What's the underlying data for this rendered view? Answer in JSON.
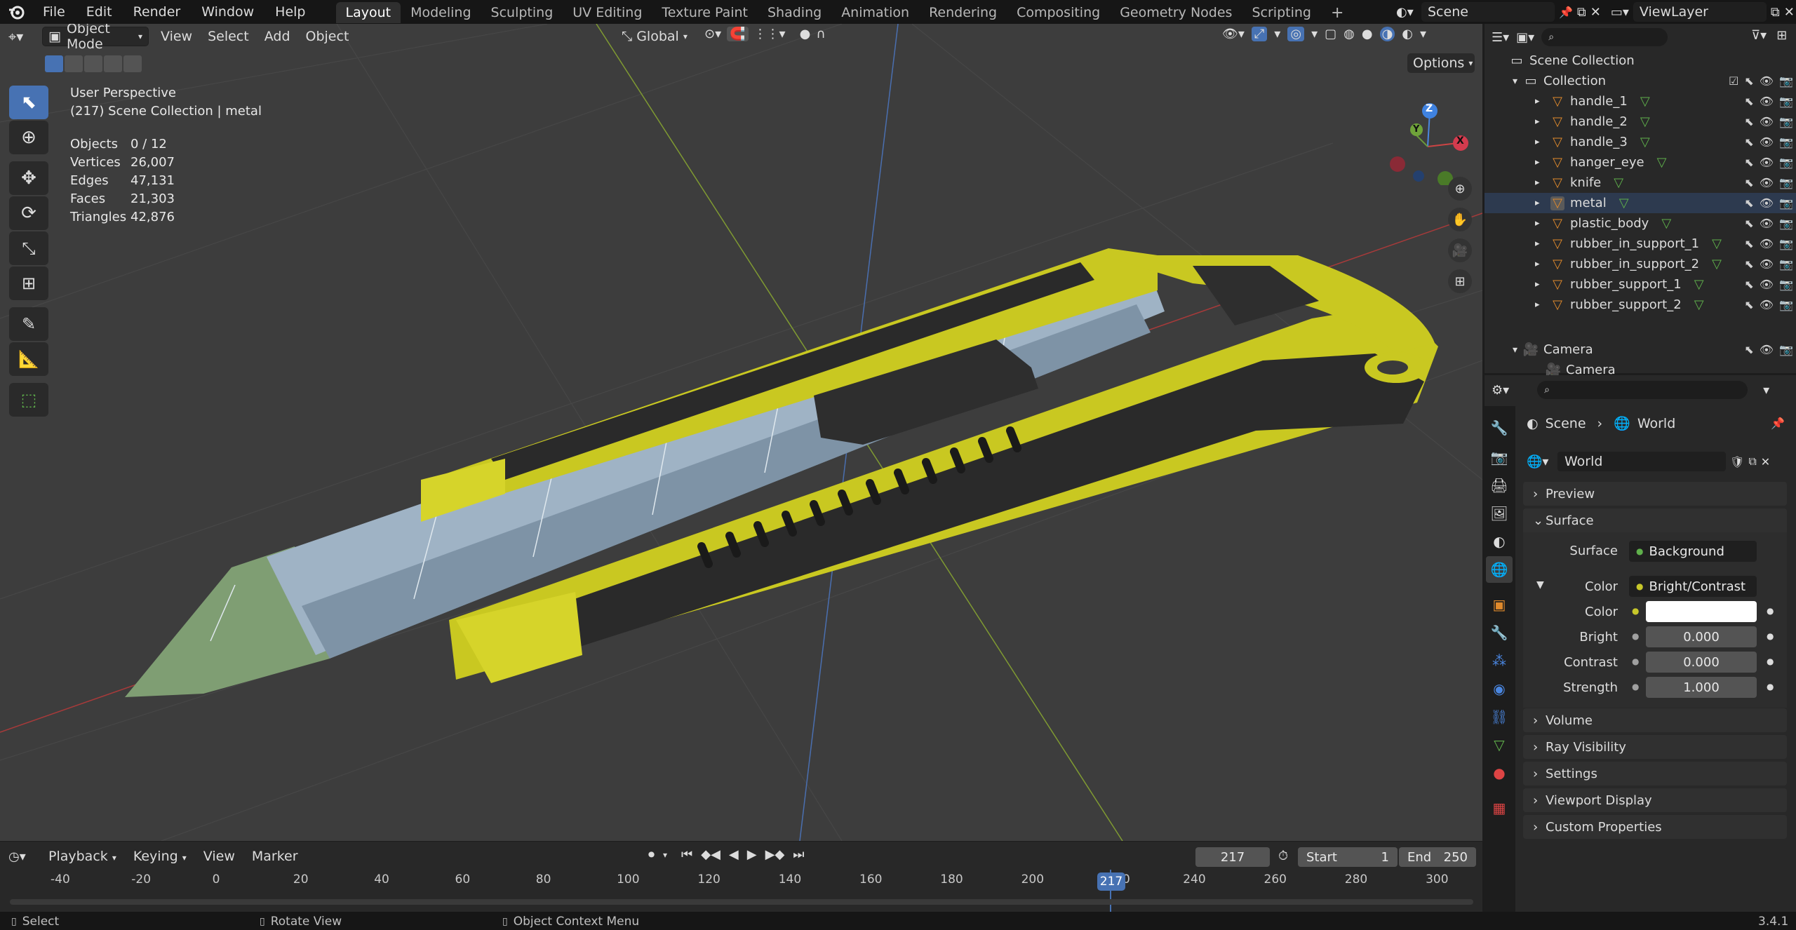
{
  "topbar": {
    "menus": [
      "File",
      "Edit",
      "Render",
      "Window",
      "Help"
    ],
    "workspaces": [
      "Layout",
      "Modeling",
      "Sculpting",
      "UV Editing",
      "Texture Paint",
      "Shading",
      "Animation",
      "Rendering",
      "Compositing",
      "Geometry Nodes",
      "Scripting"
    ],
    "active_workspace": "Layout",
    "add_tab": "+",
    "scene": "Scene",
    "view_layer": "ViewLayer"
  },
  "viewport_header": {
    "mode": "Object Mode",
    "menus": [
      "View",
      "Select",
      "Add",
      "Object"
    ],
    "transform_orientation": "Global",
    "options": "Options"
  },
  "overlay_info": {
    "view": "User Perspective",
    "context": "(217) Scene Collection | metal",
    "stats": [
      {
        "label": "Objects",
        "value": "0 / 12"
      },
      {
        "label": "Vertices",
        "value": "26,007"
      },
      {
        "label": "Edges",
        "value": "47,131"
      },
      {
        "label": "Faces",
        "value": "21,303"
      },
      {
        "label": "Triangles",
        "value": "42,876"
      }
    ]
  },
  "gizmo": {
    "x": "X",
    "y": "Y",
    "z": "Z"
  },
  "outliner": {
    "root": "Scene Collection",
    "collection": "Collection",
    "objects": [
      "handle_1",
      "handle_2",
      "handle_3",
      "hanger_eye",
      "knife",
      "metal",
      "plastic_body",
      "rubber_in_support_1",
      "rubber_in_support_2",
      "rubber_support_1",
      "rubber_support_2"
    ],
    "selected": "metal",
    "camera_object": "Camera",
    "camera_data": "Camera"
  },
  "properties": {
    "breadcrumb_scene": "Scene",
    "breadcrumb_world": "World",
    "world_name": "World",
    "panels": {
      "preview": "Preview",
      "surface": "Surface",
      "volume": "Volume",
      "ray_visibility": "Ray Visibility",
      "settings": "Settings",
      "viewport_display": "Viewport Display",
      "custom_properties": "Custom Properties"
    },
    "surface_label": "Surface",
    "surface_value": "Background",
    "color_label": "Color",
    "color_value": "Bright/Contrast",
    "sub_color_label": "Color",
    "bright_label": "Bright",
    "bright_value": "0.000",
    "contrast_label": "Contrast",
    "contrast_value": "0.000",
    "strength_label": "Strength",
    "strength_value": "1.000"
  },
  "timeline": {
    "menus": [
      "Playback",
      "Keying",
      "View",
      "Marker"
    ],
    "current_frame": "217",
    "start_label": "Start",
    "start_value": "1",
    "end_label": "End",
    "end_value": "250",
    "ruler": [
      "-40",
      "-20",
      "0",
      "20",
      "40",
      "60",
      "80",
      "100",
      "120",
      "140",
      "160",
      "180",
      "200",
      "0",
      "240",
      "260",
      "280",
      "300"
    ],
    "playhead_label": "217"
  },
  "statusbar": {
    "select": "Select",
    "rotate": "Rotate View",
    "context_menu": "Object Context Menu",
    "version": "3.4.1"
  },
  "colors": {
    "accent": "#4772b3",
    "object_orange": "#e08a2c",
    "mesh_green": "#5fb04b",
    "knife_yellow": "#d6d42a"
  }
}
